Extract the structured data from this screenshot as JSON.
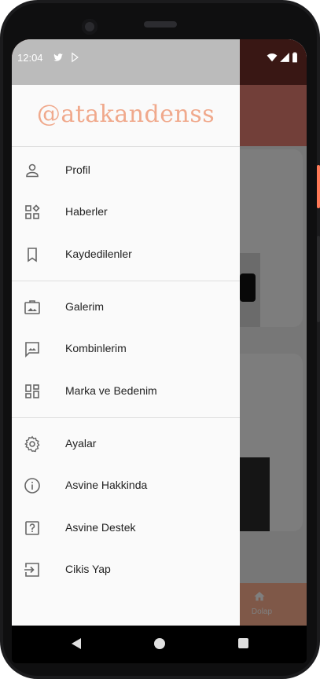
{
  "status": {
    "time": "12:04"
  },
  "drawer": {
    "username": "@atakandenss",
    "items": [
      {
        "label": "Profil",
        "icon": "person-icon"
      },
      {
        "label": "Haberler",
        "icon": "dashboard-icon"
      },
      {
        "label": "Kaydedilenler",
        "icon": "bookmark-icon"
      },
      {
        "label": "Galerim",
        "icon": "gallery-icon"
      },
      {
        "label": "Kombinlerim",
        "icon": "chat-image-icon"
      },
      {
        "label": "Marka ve Bedenim",
        "icon": "grid-icon"
      },
      {
        "label": "Ayalar",
        "icon": "settings-gear-icon"
      },
      {
        "label": "Asvine Hakkinda",
        "icon": "info-icon"
      },
      {
        "label": "Asvine Destek",
        "icon": "help-icon"
      },
      {
        "label": "Cikis Yap",
        "icon": "logout-icon"
      }
    ]
  },
  "background": {
    "bottom_nav_label": "Dolap"
  },
  "colors": {
    "accent": "#f0a98c",
    "appbar": "#e47e72"
  }
}
